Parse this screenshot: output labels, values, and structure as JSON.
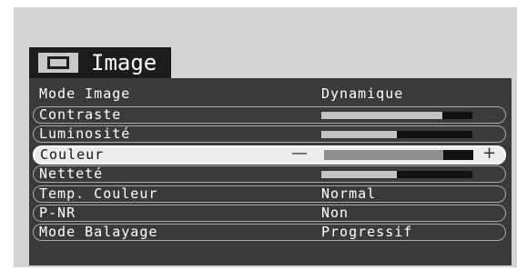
{
  "menu": {
    "title": "Image",
    "icon": "picture-icon",
    "items": [
      {
        "label": "Mode Image",
        "value": "Dynamique",
        "type": "option"
      },
      {
        "label": "Contraste",
        "type": "slider",
        "level_percent": 80
      },
      {
        "label": "Luminosité",
        "type": "slider",
        "level_percent": 50
      },
      {
        "label": "Couleur",
        "type": "slider",
        "level_percent": 80,
        "selected": true,
        "minus": "—",
        "plus": "+"
      },
      {
        "label": "Netteté",
        "type": "slider",
        "level_percent": 50
      },
      {
        "label": "Temp. Couleur",
        "value": "Normal",
        "type": "option"
      },
      {
        "label": "P-NR",
        "value": "Non",
        "type": "option"
      },
      {
        "label": "Mode Balayage",
        "value": "Progressif",
        "type": "option"
      }
    ]
  },
  "colors": {
    "background": "#d4d4d4",
    "panel": "#3a3a3a",
    "selected_row": "#ececec",
    "slider_fill": "#c4c4c4",
    "slider_track": "#111111"
  }
}
